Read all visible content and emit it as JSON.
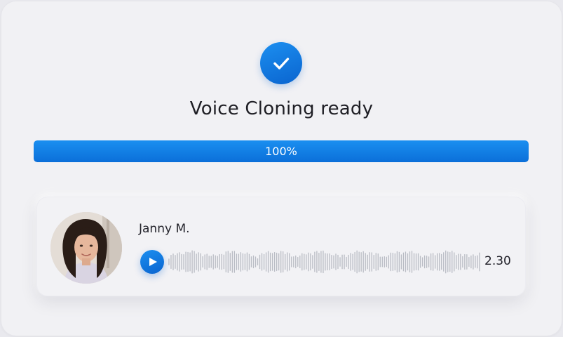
{
  "status": {
    "title": "Voice Cloning ready",
    "icon": "checkmark-icon"
  },
  "progress": {
    "value": 1.0,
    "label": "100%",
    "color": "#0b6fd9"
  },
  "voice_card": {
    "name": "Janny M.",
    "duration": "2.30",
    "play_icon": "play-icon",
    "avatar_icon": "avatar-photo"
  },
  "accent_color": "#0a64cf"
}
